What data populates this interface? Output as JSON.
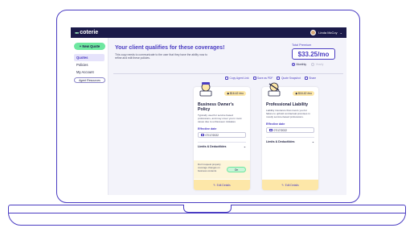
{
  "app": {
    "logo_text": "coterie",
    "user_name": "Linda McCoy"
  },
  "sidebar": {
    "new_quote": "+ New Quote",
    "items": [
      {
        "label": "Quotes",
        "active": true
      },
      {
        "label": "Policies",
        "active": false
      },
      {
        "label": "My Account",
        "active": false
      }
    ],
    "agent_resources": "Agent Resources"
  },
  "main": {
    "title": "Your client qualifies for these coverages!",
    "subtitle": "This copy needs to communicate to the user that they have the ability now to refine and edit these policies.",
    "total_label": "Total Premium",
    "total_price": "$33.25/mo",
    "frequency": {
      "monthly": "Monthly",
      "yearly": "Yearly",
      "selected": "Monthly"
    },
    "actions": [
      "Copy Agent Link",
      "Save as PDF",
      "Quote Snapshot",
      "Share"
    ]
  },
  "cards": [
    {
      "price": "$16.42 /mo",
      "title": "Business Owner's Policy",
      "description": "Typically used for service based professions, and may cover you in most cases due to unforeseen mistakes",
      "effective_label": "Effective date",
      "date": "07/17/2022",
      "limits_label": "Limits & Deductibles",
      "addon_text": "Don't request property coverage changes on business contents",
      "toggle_label": "On",
      "edit_label": "Edit Details"
    },
    {
      "price": "$16.42 /mo",
      "title": "Professional Liability",
      "description": "Liability insurance that covers you for failure to uphold contractual promises in mostly service-based professions.",
      "effective_label": "Effective date",
      "date": "07/17/2022",
      "limits_label": "Limits & Deductibles",
      "edit_label": "Edit Details"
    }
  ],
  "colors": {
    "brand": "#4a3cc2",
    "navbar": "#1b1a49",
    "accent_green": "#6ee7a0",
    "accent_yellow": "#fde7a8"
  }
}
